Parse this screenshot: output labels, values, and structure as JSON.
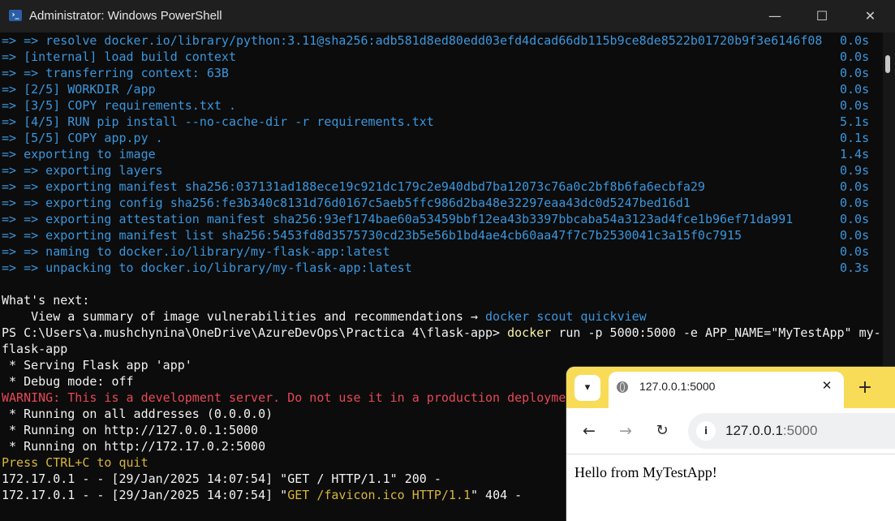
{
  "window": {
    "title": "Administrator: Windows PowerShell",
    "icon": "powershell-icon",
    "controls": {
      "minimize": "—",
      "maximize": "☐",
      "close": "✕"
    }
  },
  "terminal": {
    "build_lines": [
      {
        "text": "=> => resolve docker.io/library/python:3.11@sha256:adb581d8ed80edd03efd4dcad66db115b9ce8de8522b01720b9f3e6146f08",
        "duration": "0.0s"
      },
      {
        "text": "=> [internal] load build context",
        "duration": "0.0s"
      },
      {
        "text": "=> => transferring context: 63B",
        "duration": "0.0s"
      },
      {
        "text": "=> [2/5] WORKDIR /app",
        "duration": "0.0s"
      },
      {
        "text": "=> [3/5] COPY requirements.txt .",
        "duration": "0.0s"
      },
      {
        "text": "=> [4/5] RUN pip install --no-cache-dir -r requirements.txt",
        "duration": "5.1s"
      },
      {
        "text": "=> [5/5] COPY app.py .",
        "duration": "0.1s"
      },
      {
        "text": "=> exporting to image",
        "duration": "1.4s"
      },
      {
        "text": "=> => exporting layers",
        "duration": "0.9s"
      },
      {
        "text": "=> => exporting manifest sha256:037131ad188ece19c921dc179c2e940dbd7ba12073c76a0c2bf8b6fa6ecbfa29",
        "duration": "0.0s"
      },
      {
        "text": "=> => exporting config sha256:fe3b340c8131d76d0167c5aeb5ffc986d2ba48e32297eaa43dc0d5247bed16d1",
        "duration": "0.0s"
      },
      {
        "text": "=> => exporting attestation manifest sha256:93ef174bae60a53459bbf12ea43b3397bbcaba54a3123ad4fce1b96ef71da991",
        "duration": "0.0s"
      },
      {
        "text": "=> => exporting manifest list sha256:5453fd8d3575730cd23b5e56b1bd4ae4cb60aa47f7c7b2530041c3a15f0c7915",
        "duration": "0.0s"
      },
      {
        "text": "=> => naming to docker.io/library/my-flask-app:latest",
        "duration": "0.0s"
      },
      {
        "text": "=> => unpacking to docker.io/library/my-flask-app:latest",
        "duration": "0.3s"
      }
    ],
    "whats_next_heading": "What's next:",
    "whats_next_text": "    View a summary of image vulnerabilities and recommendations → ",
    "whats_next_command": "docker scout quickview",
    "prompt": "PS C:\\Users\\a.mushchynina\\OneDrive\\AzureDevOps\\Practica 4\\flask-app> ",
    "command_name": "docker",
    "command_args": " run -p 5000:5000 -e APP_NAME=\"MyTestApp\" my-",
    "command_wrap": "flask-app",
    "serving": " * Serving Flask app 'app'",
    "debug": " * Debug mode: off",
    "warning": "WARNING: This is a development server. Do not use it in a production deployment.",
    "running_all": " * Running on all addresses (0.0.0.0)",
    "running_local": " * Running on http://127.0.0.1:5000",
    "running_docker": " * Running on http://172.17.0.2:5000",
    "quit_hint": "Press CTRL+C to quit",
    "log1": "172.17.0.1 - - [29/Jan/2025 14:07:54] \"GET / HTTP/1.1\" 200 -",
    "log2_prefix": "172.17.0.1 - - [29/Jan/2025 14:07:54] \"",
    "log2_request": "GET /favicon.ico HTTP/1.1",
    "log2_suffix": "\" 404 -"
  },
  "browser": {
    "tab_title": "127.0.0.1:5000",
    "url_host": "127.0.0.1",
    "url_port": ":5000",
    "page_text": "Hello from MyTestApp!",
    "icons": {
      "tab_list": "chevron-down-icon",
      "tab_close": "close-icon",
      "new_tab": "plus-icon",
      "back": "back-arrow-icon",
      "forward": "forward-arrow-icon",
      "reload": "reload-icon",
      "site_info": "info-icon"
    },
    "accent_color": "#f8dc58"
  }
}
